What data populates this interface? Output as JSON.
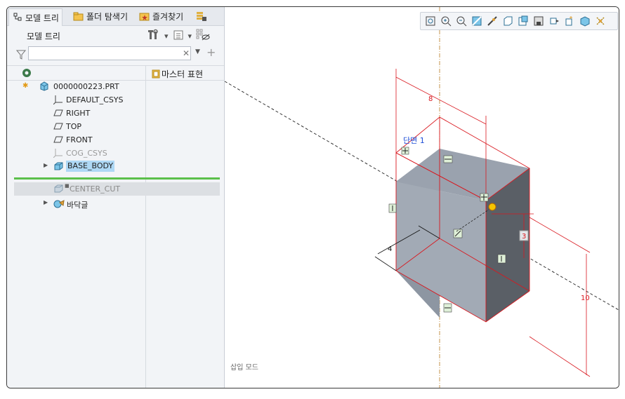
{
  "tabs": [
    {
      "label": "모델 트리",
      "icon": "model-tree-icon",
      "active": true
    },
    {
      "label": "폴더 탐색기",
      "icon": "folder-browser-icon",
      "active": false
    },
    {
      "label": "즐겨찾기",
      "icon": "favorites-icon",
      "active": false
    }
  ],
  "tree": {
    "title": "모델 트리",
    "column_label": "마스터 표현",
    "items": [
      {
        "label": "0000000223.PRT",
        "icon": "part-icon"
      },
      {
        "label": "DEFAULT_CSYS",
        "icon": "csys-icon"
      },
      {
        "label": "RIGHT",
        "icon": "datum-plane-icon"
      },
      {
        "label": "TOP",
        "icon": "datum-plane-icon"
      },
      {
        "label": "FRONT",
        "icon": "datum-plane-icon"
      },
      {
        "label": "COG_CSYS",
        "icon": "csys-icon"
      },
      {
        "label": "BASE_BODY",
        "icon": "extrude-icon"
      },
      {
        "label": "CENTER_CUT",
        "icon": "extrude-icon"
      },
      {
        "label": "바닥글",
        "icon": "footer-icon"
      }
    ]
  },
  "filter": {
    "placeholder": "",
    "value": ""
  },
  "status": "삽입 모드",
  "viewport": {
    "section_label": "단면 1",
    "dims": {
      "d8": "8",
      "d4": "4",
      "d3": "3",
      "d10": "10"
    }
  },
  "colors": {
    "accent_green": "#5bbf4a",
    "dim_red": "#d9181f",
    "body_face": "#9aa2ae",
    "selection_blue": "#aed8f5"
  },
  "toolbar_icons": [
    "refit-icon",
    "zoom-in-icon",
    "zoom-out-icon",
    "repaint-icon",
    "orient-icon",
    "display-style-icon",
    "saved-views-icon",
    "view-manager-icon",
    "perspective-icon",
    "spin-center-icon",
    "datum-display-icon",
    "annotation-display-icon"
  ]
}
